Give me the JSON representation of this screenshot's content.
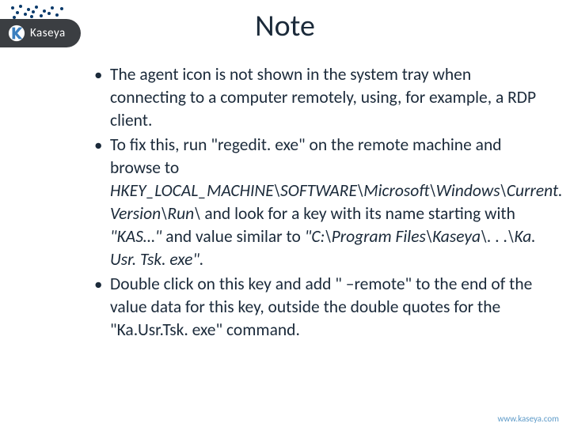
{
  "brand": {
    "name": "Kaseya",
    "url": "www.kaseya.com"
  },
  "title": "Note",
  "bullets": [
    {
      "plain_pre": "The agent icon is not shown in the system tray when connecting to a computer remotely, using, for example, a RDP client.",
      "italic_mid": "",
      "plain_mid": "",
      "italic_2": "",
      "plain_tail": ""
    },
    {
      "plain_pre": "To fix this, run \"regedit. exe\" on the remote machine and browse to ",
      "italic_mid": "HKEY_LOCAL_MACHINE\\SOFTWARE\\Microsoft\\Windows\\Current. Version\\Run\\",
      "plain_mid": " and look for a key with its name starting with ",
      "italic_2": "\"KAS…\" ",
      "plain_tail": " and value similar to ",
      "italic_3": "\"C:\\Program Files\\Kaseya\\. . .\\Ka. Usr. Tsk. exe\"."
    },
    {
      "plain_pre": "Double click on this key and add \" –remote\" to the end of the value data for this key, outside the double quotes for the \"Ka.Usr.Tsk. exe\" command.",
      "italic_mid": "",
      "plain_mid": "",
      "italic_2": "",
      "plain_tail": ""
    }
  ]
}
